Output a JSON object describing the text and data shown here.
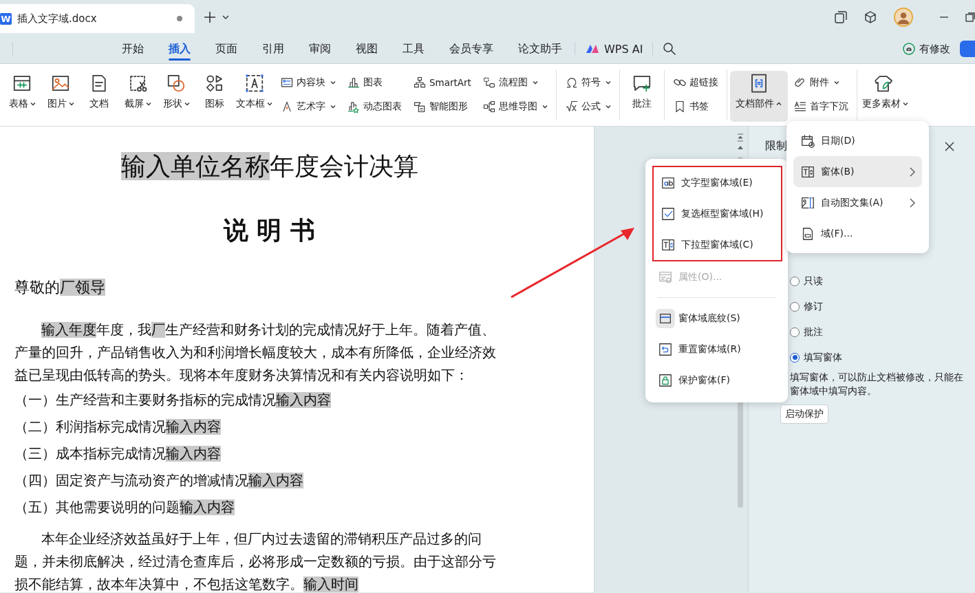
{
  "title_bar": {
    "app_logo": "W",
    "document_tab": {
      "title": "插入文字域.docx",
      "unsaved": true
    }
  },
  "menu_tabs": [
    {
      "label": "开始",
      "selected": false
    },
    {
      "label": "插入",
      "selected": true
    },
    {
      "label": "页面",
      "selected": false
    },
    {
      "label": "引用",
      "selected": false
    },
    {
      "label": "审阅",
      "selected": false
    },
    {
      "label": "视图",
      "selected": false
    },
    {
      "label": "工具",
      "selected": false
    },
    {
      "label": "会员专享",
      "selected": false
    },
    {
      "label": "论文助手",
      "selected": false
    }
  ],
  "ai_button": {
    "label": "WPS AI"
  },
  "status": {
    "label": "有修改"
  },
  "ribbon": {
    "groups": [
      {
        "items": [
          {
            "kind": "large",
            "label": "表格",
            "dropdown": true,
            "open": false
          },
          {
            "kind": "large",
            "label": "图片",
            "dropdown": true,
            "open": false
          },
          {
            "kind": "large",
            "label": "文档",
            "dropdown": false,
            "open": false
          },
          {
            "kind": "large",
            "label": "截屏",
            "dropdown": true,
            "open": false
          },
          {
            "kind": "large",
            "label": "形状",
            "dropdown": true,
            "open": false
          },
          {
            "kind": "large",
            "label": "图标",
            "dropdown": false,
            "open": false
          },
          {
            "kind": "large",
            "label": "文本框",
            "dropdown": true,
            "open": false
          },
          {
            "kind": "column",
            "entries": [
              {
                "label": "内容块",
                "dropdown": true
              },
              {
                "label": "艺术字",
                "dropdown": true
              }
            ]
          },
          {
            "kind": "column",
            "entries": [
              {
                "label": "图表",
                "dropdown": false
              },
              {
                "label": "动态图表",
                "dropdown": false
              }
            ]
          },
          {
            "kind": "column",
            "entries": [
              {
                "label": "SmartArt",
                "dropdown": false
              },
              {
                "label": "智能图形",
                "dropdown": false
              }
            ]
          },
          {
            "kind": "column",
            "entries": [
              {
                "label": "流程图",
                "dropdown": true
              },
              {
                "label": "思维导图",
                "dropdown": true
              }
            ]
          }
        ]
      },
      {
        "items": [
          {
            "kind": "column",
            "entries": [
              {
                "label": "符号",
                "dropdown": true
              },
              {
                "label": "公式",
                "dropdown": true
              }
            ]
          }
        ]
      },
      {
        "items": [
          {
            "kind": "large",
            "label": "批注",
            "dropdown": false,
            "open": false
          }
        ]
      },
      {
        "items": [
          {
            "kind": "column",
            "entries": [
              {
                "label": "超链接",
                "dropdown": false
              },
              {
                "label": "书签",
                "dropdown": false
              }
            ]
          }
        ]
      },
      {
        "items": [
          {
            "kind": "large",
            "label": "文档部件",
            "dropdown": true,
            "open": true
          },
          {
            "kind": "column",
            "entries": [
              {
                "label": "附件",
                "dropdown": true
              },
              {
                "label": "首字下沉",
                "dropdown": false
              }
            ]
          }
        ]
      },
      {
        "items": [
          {
            "kind": "large",
            "label": "更多素材",
            "dropdown": true,
            "open": false
          }
        ]
      }
    ]
  },
  "document": {
    "paragraphs": [
      {
        "kind": "title",
        "segments": [
          {
            "text": "输入单位名称",
            "highlighted": true
          },
          {
            "text": "年度会计决算",
            "highlighted": false
          }
        ]
      },
      {
        "kind": "subtitle",
        "segments": [
          {
            "text": "说 明 书",
            "highlighted": false
          }
        ]
      },
      {
        "kind": "salutation",
        "segments": [
          {
            "text": "尊敬的",
            "highlighted": false
          },
          {
            "text": "厂领导",
            "highlighted": true
          }
        ]
      },
      {
        "kind": "body",
        "segments": [
          {
            "text": "输入年度",
            "highlighted": true
          },
          {
            "text": "年度，我",
            "highlighted": false
          },
          {
            "text": "厂",
            "highlighted": true
          },
          {
            "text": "生产经营和财务计划的完成情况好于上年。随着产值、产量的回升，产品销售收入为和利润增长幅度较大，成本有所降低，企业经济效益已呈现由低转高的势头。现将本年度财务决算情况和有关内容说明如下：",
            "highlighted": false
          }
        ]
      },
      {
        "kind": "item",
        "segments": [
          {
            "text": "（一）生产经营和主要财务指标的完成情况",
            "highlighted": false
          },
          {
            "text": "输入内容",
            "highlighted": true
          }
        ]
      },
      {
        "kind": "item",
        "segments": [
          {
            "text": "（二）利润指标完成情况",
            "highlighted": false
          },
          {
            "text": "输入内容",
            "highlighted": true
          }
        ]
      },
      {
        "kind": "item",
        "segments": [
          {
            "text": "（三）成本指标完成情况",
            "highlighted": false
          },
          {
            "text": "输入内容",
            "highlighted": true
          }
        ]
      },
      {
        "kind": "item",
        "segments": [
          {
            "text": "（四）固定资产与流动资产的增减情况",
            "highlighted": false
          },
          {
            "text": "输入内容",
            "highlighted": true
          }
        ]
      },
      {
        "kind": "item",
        "segments": [
          {
            "text": "（五）其他需要说明的问题",
            "highlighted": false
          },
          {
            "text": "输入内容",
            "highlighted": true
          }
        ]
      },
      {
        "kind": "body",
        "segments": [
          {
            "text": "本年企业经济效益虽好于上年，但厂内过去遗留的滞销积压产品过多的问题，并未彻底解决，经过清仓查库后，必将形成一定数额的亏损。由于这部分亏损不能结算，故本年决算中，不包括这笔数字。",
            "highlighted": false
          },
          {
            "text": "输入时间",
            "highlighted": true
          }
        ]
      }
    ]
  },
  "panel": {
    "title": "限制",
    "options": [
      {
        "label": "只读",
        "selected": false
      },
      {
        "label": "修订",
        "selected": false
      },
      {
        "label": "批注",
        "selected": false
      },
      {
        "label": "填写窗体",
        "selected": true
      }
    ],
    "description": "填写窗体，可以防止文档被修改，只能在窗体域中填写内容。",
    "button": "启动保护"
  },
  "parts_menu": {
    "items": [
      {
        "label": "日期(D)",
        "submenu": false,
        "selected": false
      },
      {
        "label": "窗体(B)",
        "submenu": true,
        "selected": true
      },
      {
        "label": "自动图文集(A)",
        "submenu": true,
        "selected": false
      },
      {
        "label": "域(F)...",
        "submenu": false,
        "selected": false
      }
    ]
  },
  "form_menu": {
    "items": [
      {
        "kind": "item",
        "label": "文字型窗体域(E)",
        "disabled": false,
        "on": false,
        "framed": true
      },
      {
        "kind": "item",
        "label": "复选框型窗体域(H)",
        "disabled": false,
        "on": false,
        "framed": true
      },
      {
        "kind": "item",
        "label": "下拉型窗体域(C)",
        "disabled": false,
        "on": false,
        "framed": true
      },
      {
        "kind": "item",
        "label": "属性(O)...",
        "disabled": true,
        "on": false,
        "framed": false
      },
      {
        "kind": "separator"
      },
      {
        "kind": "item",
        "label": "窗体域底纹(S)",
        "disabled": false,
        "on": true,
        "framed": false
      },
      {
        "kind": "item",
        "label": "重置窗体域(R)",
        "disabled": false,
        "on": false,
        "framed": false
      },
      {
        "kind": "item",
        "label": "保护窗体(F)",
        "disabled": false,
        "on": false,
        "framed": false
      }
    ]
  },
  "annotation": {
    "arrow": true
  }
}
